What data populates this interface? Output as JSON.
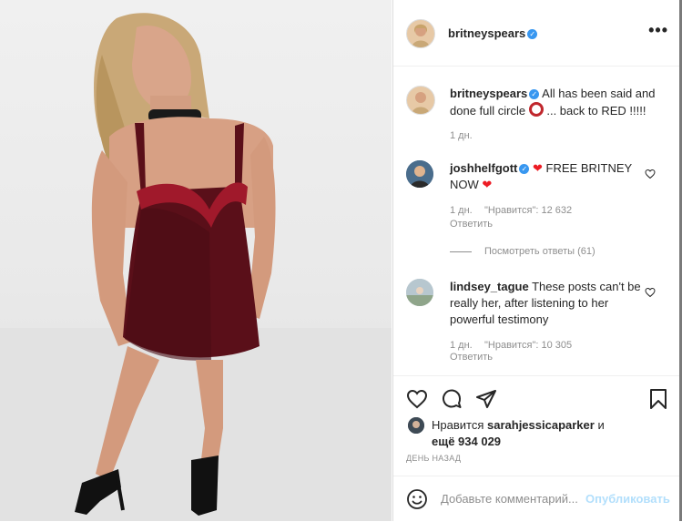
{
  "post": {
    "author": "britneyspears",
    "more_glyph": "•••"
  },
  "caption": {
    "username": "britneyspears",
    "text": "All has been said and done full circle",
    "text_tail": "... back to RED !!!!!",
    "time": "1 дн."
  },
  "comments": [
    {
      "username": "joshhelfgott",
      "verified": true,
      "text": "FREE BRITNEY NOW",
      "time": "1 дн.",
      "likes_label": "\"Нравится\": 12 632",
      "reply_label": "Ответить",
      "view_replies": "Посмотреть ответы (61)"
    },
    {
      "username": "lindsey_tague",
      "verified": false,
      "text": "These posts can't be really her, after listening to her powerful testimony",
      "time": "1 дн.",
      "likes_label": "\"Нравится\": 10 305",
      "reply_label": "Ответить"
    }
  ],
  "likes": {
    "prefix": "Нравится",
    "user": "sarahjessicaparker",
    "and": "и",
    "count_text": "ещё 934 029"
  },
  "date_label": "ДЕНЬ НАЗАД",
  "add_comment": {
    "placeholder": "Добавьте комментарий...",
    "post_label": "Опубликовать"
  },
  "colors": {
    "link_blue": "#0095f6",
    "post_disabled": "#b2dffc",
    "verified": "#3897f0",
    "heart_red": "#ed1c24",
    "muted": "#8e8e8e"
  },
  "icons": {
    "like": "heart-outline-icon",
    "comment": "speech-bubble-icon",
    "share": "paper-plane-icon",
    "save": "bookmark-icon",
    "emoji": "smiley-icon",
    "more": "ellipsis-icon"
  }
}
